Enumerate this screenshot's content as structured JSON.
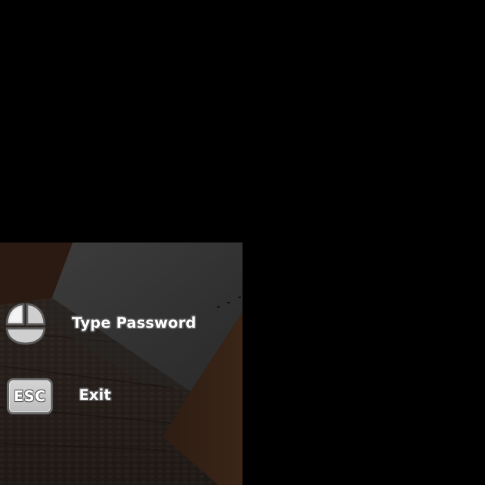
{
  "colors": {
    "background": "#000000",
    "icon_fill": "#cfcfcf",
    "icon_outline": "#5a5a5a",
    "label_text": "#ffffff"
  },
  "controls": [
    {
      "icon": "mouse-left-click-icon",
      "label": "Type Password"
    },
    {
      "icon": "esc-key-icon",
      "key": "ESC",
      "label": "Exit"
    }
  ]
}
